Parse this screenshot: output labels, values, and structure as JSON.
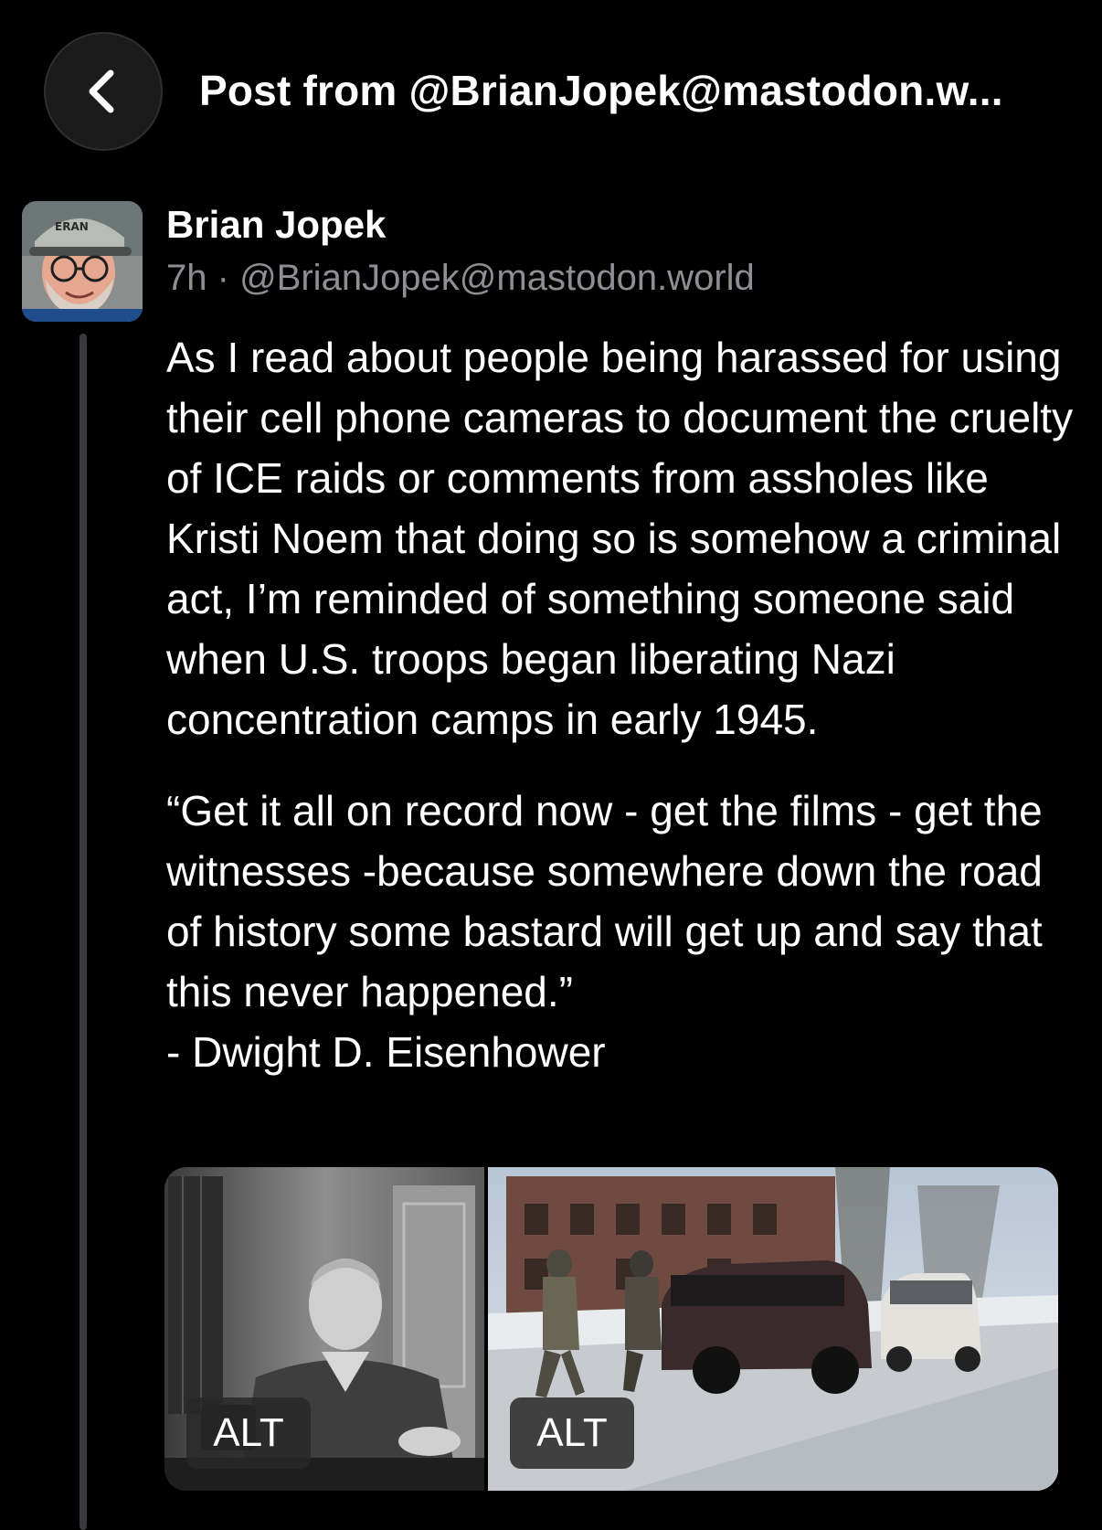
{
  "header": {
    "title": "Post from @BrianJopek@mastodon.w...",
    "back_icon": "chevron-left-icon"
  },
  "post": {
    "author_name": "Brian Jopek",
    "time": "7h",
    "separator": "·",
    "handle": "@BrianJopek@mastodon.world",
    "paragraphs": [
      "As I read about people being harassed for using their cell phone cameras to document the cruelty of ICE raids or comments from assholes like Kristi Noem that doing so is somehow a criminal act, I’m reminded of something someone said when U.S. troops began liberating Nazi concentration camps in early 1945.",
      "“Get it all on record now - get the films - get the witnesses -because somewhere down the road of history some bastard will get up and say that this never happened.”\n- Dwight D. Eisenhower"
    ],
    "media": [
      {
        "alt_label": "ALT"
      },
      {
        "alt_label": "ALT"
      }
    ]
  },
  "colors": {
    "background": "#000000",
    "text": "#ffffff",
    "meta": "#8e8e93",
    "thread_line": "#3a3a3c"
  }
}
